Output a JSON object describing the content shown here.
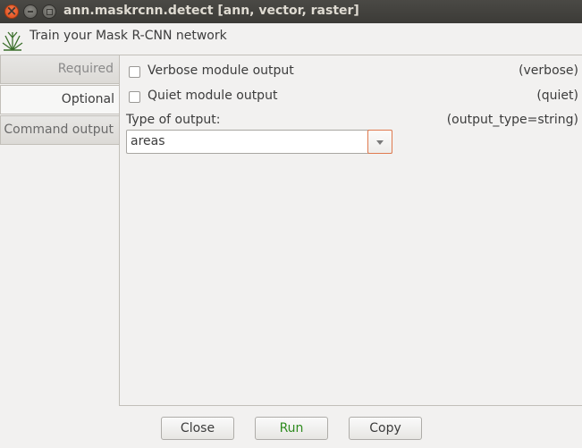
{
  "window": {
    "title": "ann.maskrcnn.detect [ann, vector, raster]",
    "controls": [
      "close-icon",
      "minimize-icon",
      "maximize-icon"
    ]
  },
  "header": {
    "description": "Train your Mask R-CNN network",
    "logo_icon": "grass-logo-icon"
  },
  "tabs": [
    {
      "label": "Required",
      "active": false
    },
    {
      "label": "Optional",
      "active": true
    },
    {
      "label": "Command output",
      "active": false
    }
  ],
  "options": {
    "verbose": {
      "label": "Verbose module output",
      "param": "(verbose)",
      "checked": false
    },
    "quiet": {
      "label": "Quiet module output",
      "param": "(quiet)",
      "checked": false
    },
    "output_type": {
      "label": "Type of output:",
      "param": "(output_type=string)",
      "value": "areas"
    }
  },
  "buttons": {
    "close": "Close",
    "run": "Run",
    "copy": "Copy"
  },
  "colors": {
    "titlebar": "#3c3b37",
    "close_button": "#df4a16",
    "run_text": "#2e8b1e",
    "focus_border": "#e07a4f"
  }
}
